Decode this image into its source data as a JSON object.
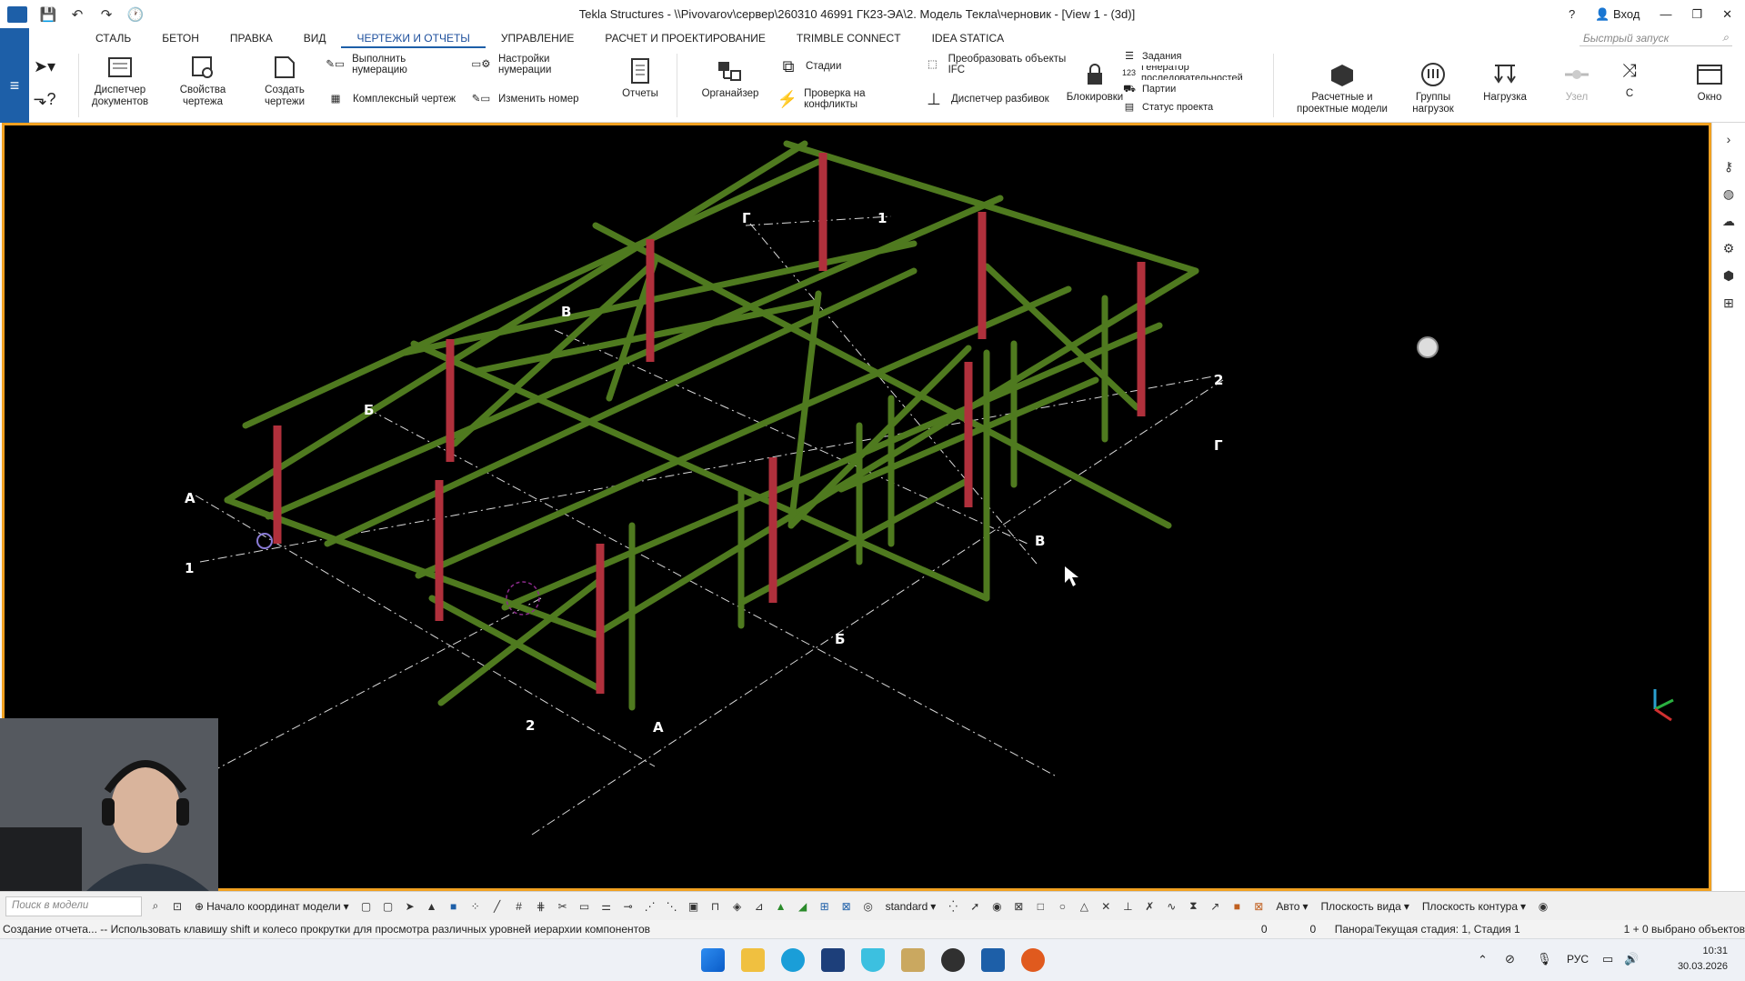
{
  "window": {
    "title": "Tekla Structures - \\\\Pivovarov\\сервер\\260310 46991 ГК23-ЭА\\2. Модель Текла\\черновик  - [View 1 - (3d)]",
    "login": "Вход"
  },
  "menu": {
    "items": [
      "СТАЛЬ",
      "БЕТОН",
      "ПРАВКА",
      "ВИД",
      "ЧЕРТЕЖИ И ОТЧЕТЫ",
      "УПРАВЛЕНИЕ",
      "РАСЧЕТ И ПРОЕКТИРОВАНИЕ",
      "TRIMBLE CONNECT",
      "IDEA STATICA"
    ],
    "active_index": 4,
    "quick_launch_placeholder": "Быстрый запуск"
  },
  "ribbon": {
    "doc_manager": "Диспетчер документов",
    "drawing_props": "Свойства чертежа",
    "create_drawings": "Создать чертежи",
    "run_numbering": "Выполнить нумерацию",
    "numbering_settings": "Настройки нумерации",
    "complex_drawing": "Комплексный чертеж",
    "change_number": "Изменить номер",
    "reports": "Отчеты",
    "organizer": "Органайзер",
    "stages": "Стадии",
    "clash_check": "Проверка на конфликты",
    "convert_ifc": "Преобразовать объекты IFC",
    "layout_manager": "Диспетчер разбивок",
    "locks": "Блокировки",
    "tasks": "Задания",
    "sequence_gen": "Генератор последовательностей",
    "lots": "Партии",
    "project_status": "Статус проекта",
    "analysis_models": "Расчетные и проектные модели",
    "load_groups": "Группы нагрузок",
    "load": "Нагрузка",
    "node": "Узел",
    "c": "С",
    "window": "Окно"
  },
  "viewport": {
    "grid_labels": {
      "a1": "А",
      "a2": "А",
      "b1": "Б",
      "b2": "Б",
      "v1": "В",
      "v2": "В",
      "g1": "Г",
      "g2": "Г",
      "n1a": "1",
      "n1b": "1",
      "n2a": "2",
      "n2b": "2"
    }
  },
  "bottombar": {
    "search_placeholder": "Поиск в модели",
    "origin": "Начало координат модели",
    "standard": "standard",
    "auto": "Авто",
    "view_plane": "Плоскость вида",
    "contour_plane": "Плоскость контура"
  },
  "status": {
    "message": "Создание отчета... -- Использовать клавишу shift и колесо прокрутки для просмотра различных уровней иерархии компонентов",
    "zero1": "0",
    "zero2": "0",
    "pan": "Панорама",
    "stage": "Текущая стадия: 1, Стадия 1",
    "selected": "1 + 0 выбрано объектов"
  },
  "taskbar": {
    "lang": "РУС",
    "time": "10:31",
    "date": "30.03.2026"
  },
  "colors": {
    "accent": "#1d5fa8",
    "beam": "#4f7a1f",
    "column": "#b0303c",
    "viewport_border": "#f0a020"
  }
}
